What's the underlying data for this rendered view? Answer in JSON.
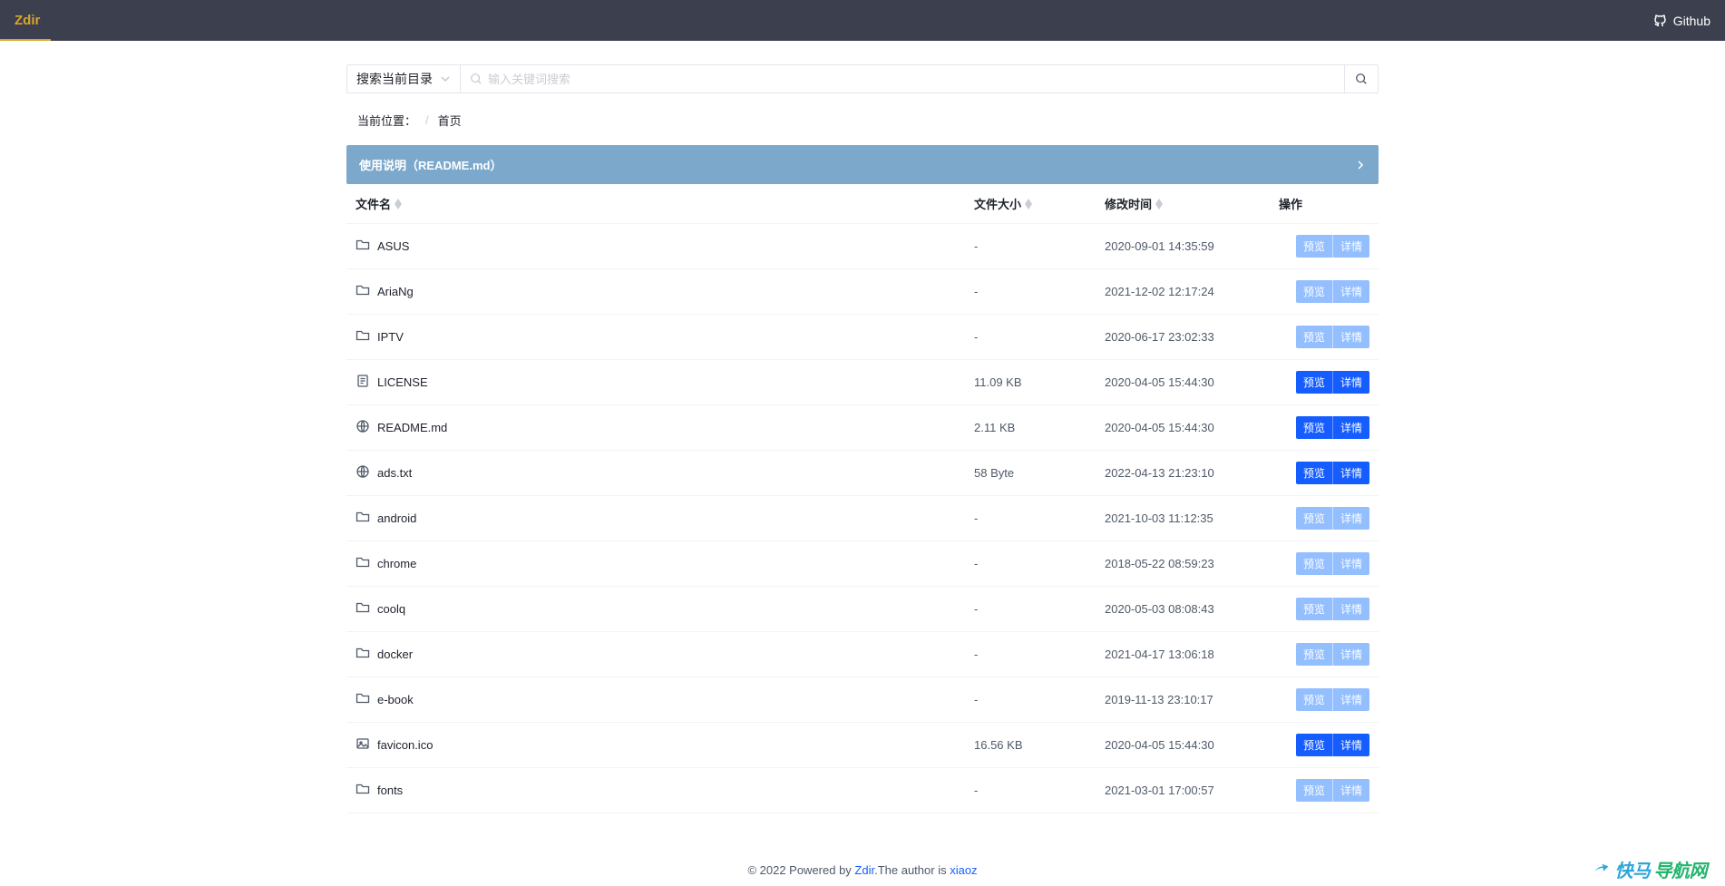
{
  "header": {
    "brand": "Zdir",
    "github": "Github"
  },
  "search": {
    "scope_label": "搜索当前目录",
    "placeholder": "输入关键词搜索"
  },
  "breadcrumb": {
    "label": "当前位置：",
    "sep": "/",
    "home": "首页"
  },
  "readme": {
    "label": "使用说明（README.md）"
  },
  "columns": {
    "name": "文件名",
    "size": "文件大小",
    "time": "修改时间",
    "ops": "操作"
  },
  "ops": {
    "preview": "预览",
    "detail": "详情"
  },
  "rows": [
    {
      "icon": "folder",
      "name": "ASUS",
      "size": "-",
      "time": "2020-09-01 14:35:59",
      "style": "light"
    },
    {
      "icon": "folder",
      "name": "AriaNg",
      "size": "-",
      "time": "2021-12-02 12:17:24",
      "style": "light"
    },
    {
      "icon": "folder",
      "name": "IPTV",
      "size": "-",
      "time": "2020-06-17 23:02:33",
      "style": "light"
    },
    {
      "icon": "file",
      "name": "LICENSE",
      "size": "11.09 KB",
      "time": "2020-04-05 15:44:30",
      "style": "solid"
    },
    {
      "icon": "md",
      "name": "README.md",
      "size": "2.11 KB",
      "time": "2020-04-05 15:44:30",
      "style": "solid"
    },
    {
      "icon": "md",
      "name": "ads.txt",
      "size": "58 Byte",
      "time": "2022-04-13 21:23:10",
      "style": "solid"
    },
    {
      "icon": "folder",
      "name": "android",
      "size": "-",
      "time": "2021-10-03 11:12:35",
      "style": "light"
    },
    {
      "icon": "folder",
      "name": "chrome",
      "size": "-",
      "time": "2018-05-22 08:59:23",
      "style": "light"
    },
    {
      "icon": "folder",
      "name": "coolq",
      "size": "-",
      "time": "2020-05-03 08:08:43",
      "style": "light"
    },
    {
      "icon": "folder",
      "name": "docker",
      "size": "-",
      "time": "2021-04-17 13:06:18",
      "style": "light"
    },
    {
      "icon": "folder",
      "name": "e-book",
      "size": "-",
      "time": "2019-11-13 23:10:17",
      "style": "light"
    },
    {
      "icon": "image",
      "name": "favicon.ico",
      "size": "16.56 KB",
      "time": "2020-04-05 15:44:30",
      "style": "solid"
    },
    {
      "icon": "folder",
      "name": "fonts",
      "size": "-",
      "time": "2021-03-01 17:00:57",
      "style": "light"
    }
  ],
  "footer": {
    "prefix": "© 2022 Powered by ",
    "link1": "Zdir",
    "mid": ".The author is ",
    "link2": "xiaoz"
  },
  "watermark": {
    "part1": "快马",
    "part2": "导航网"
  }
}
